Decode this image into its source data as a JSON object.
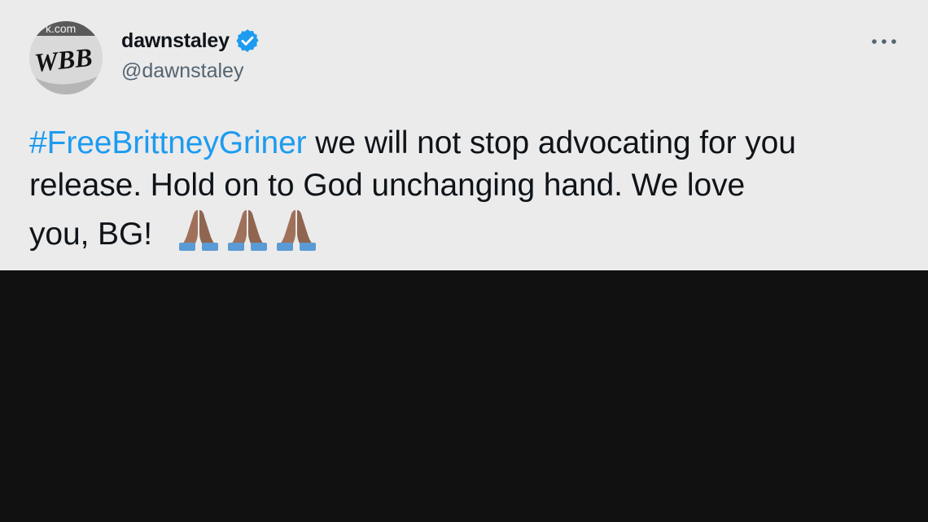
{
  "tweet": {
    "avatar": {
      "logo_text": "WBB",
      "watermark_text": "k.com"
    },
    "author": {
      "display_name": "dawnstaley",
      "handle": "@dawnstaley",
      "verified": true
    },
    "body": {
      "hashtag": "#FreeBrittneyGriner",
      "line1_rest": " we will not stop advocating for you",
      "line2": "release.  Hold on to God unchanging hand.  We love",
      "line3": "you, BG!",
      "emoji_icons": [
        "folded-hands-icon",
        "folded-hands-icon",
        "folded-hands-icon"
      ]
    },
    "colors": {
      "card_background": "#ebebeb",
      "hashtag": "#1d9bf0",
      "verified_badge": "#1d9bf0",
      "text": "#0f1419",
      "handle": "#536471",
      "lower_panel": "#111111"
    },
    "menu_icon": "more-horizontal-icon"
  }
}
